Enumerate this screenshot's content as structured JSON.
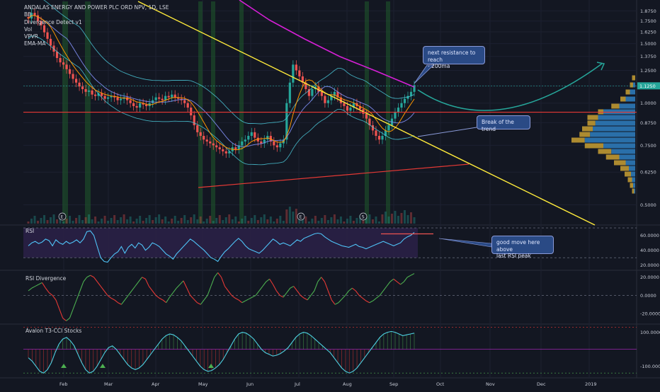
{
  "chart_data": [
    {
      "type": "candlestick",
      "title": "ANDALAS ENERGY AND POWER PLC ORD NPV, 1D, LSE",
      "indicators": [
        "BB",
        "Divergence Detect v1",
        "Vol",
        "VPVR",
        "EMA-MA"
      ],
      "y_ticks": [
        "1.8750",
        "1.7500",
        "1.6250",
        "1.5000",
        "1.3750",
        "1.2500",
        "1.1250",
        "1.0000",
        "0.8750",
        "0.7500",
        "0.6250",
        "0.5000"
      ],
      "y_scale": "log",
      "last_price": "1.1250",
      "ylim": [
        0.44,
        2.0
      ],
      "close": [
        1.78,
        1.85,
        1.82,
        1.75,
        1.7,
        1.62,
        1.55,
        1.48,
        1.42,
        1.36,
        1.32,
        1.3,
        1.26,
        1.22,
        1.18,
        1.15,
        1.12,
        1.1,
        1.08,
        1.09,
        1.06,
        1.05,
        1.07,
        1.05,
        1.03,
        1.04,
        1.05,
        1.04,
        1.02,
        1.03,
        1.04,
        1.02,
        1.0,
        0.98,
        0.97,
        1.0,
        0.99,
        0.98,
        1.0,
        1.02,
        1.04,
        1.03,
        1.02,
        1.05,
        1.04,
        1.06,
        1.04,
        1.03,
        1.02,
        1.0,
        0.97,
        0.92,
        0.86,
        0.82,
        0.8,
        0.78,
        0.77,
        0.76,
        0.75,
        0.74,
        0.73,
        0.72,
        0.71,
        0.72,
        0.74,
        0.73,
        0.75,
        0.77,
        0.78,
        0.8,
        0.82,
        0.79,
        0.77,
        0.76,
        0.78,
        0.8,
        0.77,
        0.75,
        0.74,
        0.76,
        0.78,
        1.0,
        1.15,
        1.3,
        1.25,
        1.2,
        1.15,
        1.1,
        1.05,
        1.1,
        1.12,
        1.08,
        1.05,
        1.0,
        1.02,
        1.05,
        1.08,
        1.04,
        1.0,
        0.98,
        0.95,
        0.97,
        1.0,
        0.98,
        0.96,
        0.93,
        0.9,
        0.86,
        0.83,
        0.8,
        0.78,
        0.8,
        0.83,
        0.86,
        0.9,
        0.94,
        0.97,
        1.0,
        1.03,
        1.05,
        1.08,
        1.13
      ],
      "bands": [
        "upper Bollinger band",
        "lower Bollinger band",
        "basis",
        "EMA",
        "MA",
        "200ma"
      ],
      "annotations": [
        {
          "text": "next resistance to reach\n- 200ma"
        },
        {
          "text": "Break of the trend"
        }
      ],
      "event_markers": [
        "E",
        "E",
        "S"
      ]
    },
    {
      "type": "line",
      "title": "RSI",
      "y_ticks": [
        "60.0000",
        "40.0000",
        "20.0000"
      ],
      "ylim": [
        15,
        72
      ],
      "bands": [
        30,
        70
      ],
      "values": [
        46,
        50,
        52,
        49,
        51,
        55,
        53,
        46,
        54,
        50,
        48,
        52,
        49,
        51,
        54,
        50,
        55,
        65,
        66,
        60,
        45,
        30,
        25,
        24,
        30,
        35,
        38,
        45,
        36,
        44,
        48,
        43,
        50,
        47,
        40,
        44,
        50,
        48,
        45,
        40,
        35,
        32,
        28,
        35,
        40,
        45,
        50,
        55,
        52,
        48,
        44,
        40,
        35,
        30,
        28,
        25,
        32,
        38,
        42,
        47,
        52,
        56,
        52,
        46,
        42,
        40,
        38,
        36,
        40,
        45,
        50,
        55,
        52,
        48,
        50,
        48,
        46,
        50,
        54,
        52,
        56,
        58,
        60,
        62,
        63,
        62,
        58,
        55,
        52,
        50,
        48,
        46,
        45,
        44,
        46,
        48,
        45,
        44,
        42,
        44,
        46,
        48,
        50,
        52,
        50,
        48,
        46,
        48,
        50,
        55,
        58,
        60,
        64
      ],
      "annotation": "good move here above\nlast RSI peak"
    },
    {
      "type": "line",
      "title": "RSI Divergence",
      "y_ticks": [
        "20.0000",
        "0.0000",
        "-20.0000"
      ],
      "ylim": [
        -30,
        26
      ],
      "values": [
        5,
        8,
        10,
        12,
        14,
        8,
        3,
        0,
        -5,
        -15,
        -25,
        -28,
        -25,
        -15,
        -5,
        5,
        15,
        20,
        22,
        20,
        15,
        10,
        5,
        0,
        -3,
        -5,
        -8,
        -10,
        -5,
        0,
        5,
        10,
        15,
        20,
        18,
        10,
        5,
        0,
        -3,
        -5,
        -8,
        -2,
        3,
        8,
        12,
        16,
        8,
        0,
        -4,
        -8,
        -10,
        -5,
        0,
        10,
        20,
        25,
        20,
        10,
        5,
        0,
        -3,
        -5,
        -8,
        -6,
        -4,
        -2,
        0,
        5,
        10,
        15,
        18,
        12,
        5,
        0,
        -2,
        3,
        8,
        10,
        5,
        0,
        -3,
        -5,
        0,
        5,
        15,
        20,
        15,
        5,
        -5,
        -10,
        -8,
        -4,
        0,
        5,
        8,
        5,
        0,
        -3,
        -6,
        -8,
        -6,
        -3,
        0,
        5,
        10,
        15,
        18,
        15,
        12,
        15,
        20,
        22,
        24
      ]
    },
    {
      "type": "line",
      "title": "Avalon T3-CCI Stocks",
      "y_ticks": [
        "100.0000",
        "-100.0000"
      ],
      "ylim": [
        -160,
        140
      ],
      "values": [
        -50,
        -70,
        -100,
        -130,
        -140,
        -120,
        -80,
        -20,
        30,
        60,
        70,
        50,
        20,
        -30,
        -80,
        -120,
        -140,
        -130,
        -100,
        -60,
        -20,
        10,
        20,
        0,
        -30,
        -60,
        -90,
        -110,
        -120,
        -110,
        -90,
        -60,
        -30,
        0,
        30,
        60,
        80,
        90,
        85,
        70,
        50,
        20,
        -10,
        -40,
        -70,
        -100,
        -120,
        -130,
        -125,
        -110,
        -90,
        -60,
        -20,
        20,
        60,
        90,
        100,
        95,
        80,
        60,
        30,
        0,
        -20,
        -30,
        -40,
        -35,
        -25,
        -10,
        10,
        40,
        70,
        90,
        100,
        95,
        80,
        60,
        40,
        20,
        0,
        -20,
        -50,
        -80,
        -110,
        -130,
        -140,
        -130,
        -110,
        -80,
        -50,
        -20,
        10,
        40,
        70,
        90,
        100,
        105,
        100,
        90,
        80,
        85,
        90,
        95
      ]
    }
  ],
  "x_axis_labels": [
    "Feb",
    "Mar",
    "Apr",
    "May",
    "Jun",
    "Jul",
    "Aug",
    "Sep",
    "Oct",
    "Nov",
    "Dec",
    "2019"
  ],
  "colors": {
    "bg": "#131722",
    "up": "#26a69a",
    "down": "#ef5350",
    "ma200": "#d61fd6",
    "trendline": "#ffeb3b",
    "support": "#e53935",
    "bb": "#4dd0e1",
    "ema": "#ff9800",
    "ma": "#7e8cf0",
    "rsi": "#4fc3f7",
    "rsi_bg": "#2a2046",
    "vpvr_up": "#2f7fc1",
    "vpvr_down": "#c9a032"
  }
}
